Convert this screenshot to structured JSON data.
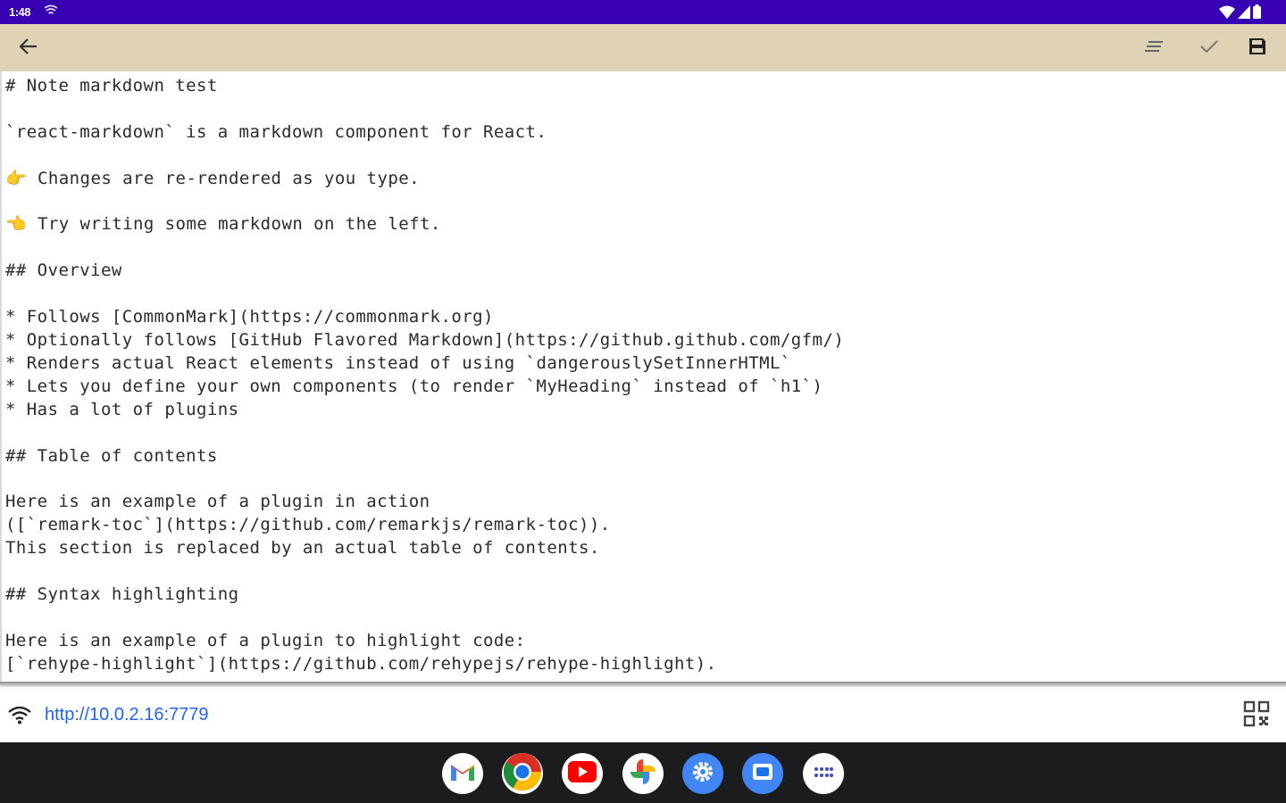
{
  "status_bar": {
    "time": "1:48",
    "icons": [
      "cast-icon",
      "wifi-signal-icon",
      "cellular-signal-icon",
      "battery-icon"
    ]
  },
  "toolbar": {
    "icons": [
      "back-arrow-icon",
      "format-list-icon",
      "check-icon",
      "save-icon"
    ]
  },
  "editor": {
    "content": "# Note markdown test\n\n`react-markdown` is a markdown component for React.\n\n👉 Changes are re-rendered as you type.\n\n👈 Try writing some markdown on the left.\n\n## Overview\n\n* Follows [CommonMark](https://commonmark.org)\n* Optionally follows [GitHub Flavored Markdown](https://github.github.com/gfm/)\n* Renders actual React elements instead of using `dangerouslySetInnerHTML`\n* Lets you define your own components (to render `MyHeading` instead of `h1`)\n* Has a lot of plugins\n\n## Table of contents\n\nHere is an example of a plugin in action\n([`remark-toc`](https://github.com/remarkjs/remark-toc)).\nThis section is replaced by an actual table of contents.\n\n## Syntax highlighting\n\nHere is an example of a plugin to highlight code:\n[`rehype-highlight`](https://github.com/rehypejs/rehype-highlight).\n"
  },
  "server": {
    "url": "http://10.0.2.16:7779",
    "icons": [
      "wifi-icon",
      "qr-code-icon"
    ]
  },
  "taskbar": {
    "apps": [
      "gmail-icon",
      "chrome-icon",
      "youtube-icon",
      "photos-icon",
      "settings-icon",
      "files-icon",
      "app-drawer-icon"
    ],
    "colors": {
      "youtube": "#ff0000",
      "chrome_green": "#1e8e3e",
      "chrome_yellow": "#fbbc04",
      "chrome_red": "#d93025",
      "chrome_blue": "#1a73e8",
      "settings_blue": "#4285f4"
    }
  },
  "colors": {
    "status_bar": "#3800b3",
    "toolbar": "#e0d2b4",
    "link": "#2563eb",
    "taskbar": "#1c1c1e"
  }
}
